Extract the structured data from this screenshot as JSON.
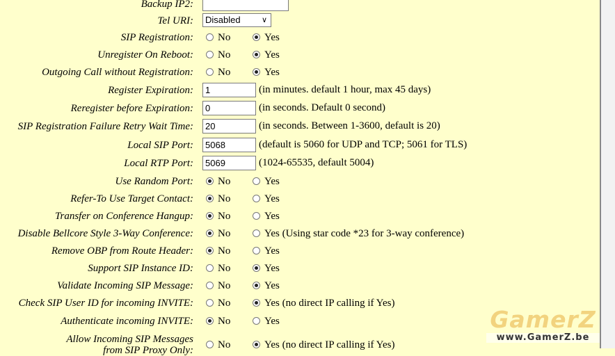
{
  "watermark": {
    "logo": "GamerZ",
    "url": "www.GamerZ.be"
  },
  "rows": [
    {
      "label": "Backup IP2:",
      "type": "text",
      "value": ""
    },
    {
      "label": "Tel URI:",
      "type": "select",
      "value": "Disabled"
    },
    {
      "label": "SIP Registration:",
      "type": "radio",
      "a": "No",
      "b": "Yes",
      "selected": "b"
    },
    {
      "label": "Unregister On Reboot:",
      "type": "radio",
      "a": "No",
      "b": "Yes",
      "selected": "b"
    },
    {
      "label": "Outgoing Call without Registration:",
      "type": "radio",
      "a": "No",
      "b": "Yes",
      "selected": "b"
    },
    {
      "label": "Register Expiration:",
      "type": "text",
      "value": "1",
      "hint": "(in minutes. default 1 hour, max 45 days)"
    },
    {
      "label": "Reregister before Expiration:",
      "type": "text",
      "value": "0",
      "hint": "(in seconds. Default 0 second)"
    },
    {
      "label": "SIP Registration Failure Retry Wait Time:",
      "type": "text",
      "value": "20",
      "hint": "(in seconds. Between 1-3600, default is 20)"
    },
    {
      "label": "Local SIP Port:",
      "type": "text",
      "value": "5068",
      "hint": "(default is 5060 for UDP and TCP; 5061 for TLS)"
    },
    {
      "label": "Local RTP Port:",
      "type": "text",
      "value": "5069",
      "hint": "(1024-65535, default 5004)"
    },
    {
      "label": "Use Random Port:",
      "type": "radio",
      "a": "No",
      "b": "Yes",
      "selected": "a"
    },
    {
      "label": "Refer-To Use Target Contact:",
      "type": "radio",
      "a": "No",
      "b": "Yes",
      "selected": "a"
    },
    {
      "label": "Transfer on Conference Hangup:",
      "type": "radio",
      "a": "No",
      "b": "Yes",
      "selected": "a"
    },
    {
      "label": "Disable Bellcore Style 3-Way Conference:",
      "type": "radio",
      "a": "No",
      "b": "Yes (Using star code *23 for 3-way conference)",
      "selected": "a"
    },
    {
      "label": "Remove OBP from Route Header:",
      "type": "radio",
      "a": "No",
      "b": "Yes",
      "selected": "a"
    },
    {
      "label": "Support SIP Instance ID:",
      "type": "radio",
      "a": "No",
      "b": "Yes",
      "selected": "b"
    },
    {
      "label": "Validate Incoming SIP Message:",
      "type": "radio",
      "a": "No",
      "b": "Yes",
      "selected": "b"
    },
    {
      "label": "Check SIP User ID for incoming INVITE:",
      "type": "radio",
      "a": "No",
      "b": "Yes (no direct IP calling if Yes)",
      "selected": "b"
    },
    {
      "label": "Authenticate incoming INVITE:",
      "type": "radio",
      "a": "No",
      "b": "Yes",
      "selected": "a"
    },
    {
      "label": "Allow Incoming SIP Messages",
      "label2": "from SIP Proxy Only:",
      "type": "radio",
      "a": "No",
      "b": "Yes (no direct IP calling if Yes)",
      "selected": "b"
    }
  ]
}
